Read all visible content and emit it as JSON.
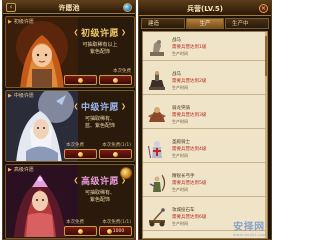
{
  "left_panel": {
    "title": "许愿池",
    "back_icon": "back-arrow-icon",
    "gem_icon": "gem-icon",
    "pools": [
      {
        "tag": "初级许愿",
        "name": "初级许愿",
        "desc_line1": "可抽取稀有以上",
        "desc_line2": "紫色配饰",
        "free_left": "",
        "free_right": "本次免费",
        "price": "",
        "accent": "#f0c868"
      },
      {
        "tag": "中级许愿",
        "name": "中级许愿",
        "desc_line1": "可抽取稀有、",
        "desc_line2": "蓝、紫色配饰",
        "free_left": "本次免费",
        "free_right": "本次免费(1/1)",
        "price": "",
        "accent": "#9fb8f0"
      },
      {
        "tag": "高级许愿",
        "name": "高级许愿",
        "desc_line1": "可抽取稀有、",
        "desc_line2": "紫色配饰",
        "free_left": "本次免费",
        "free_right": "本次免费(1/1)",
        "price": "1000",
        "accent": "#e89ad8"
      }
    ]
  },
  "right_panel": {
    "title": "兵营(LV.5)",
    "close_icon": "close-icon",
    "tabs": [
      "建造",
      "生产",
      "生产中"
    ],
    "active_tab": 1,
    "units": [
      {
        "name": "战马",
        "req": "需要兵营达到1级",
        "time": "生产时间",
        "icon": "horse-statue-icon"
      },
      {
        "name": "战马",
        "req": "需要兵营达到2级",
        "time": "生产时间",
        "icon": "mounted-unit-icon"
      },
      {
        "name": "骑龙突骑",
        "req": "需要兵营达到3级",
        "time": "生产时间",
        "icon": "dragon-rider-icon"
      },
      {
        "name": "圣殿骑士",
        "req": "需要兵营达到4级",
        "time": "生产时间",
        "icon": "templar-knight-icon"
      },
      {
        "name": "精锐长弓手",
        "req": "需要兵营达到5级",
        "time": "生产时间",
        "icon": "longbow-archer-icon"
      },
      {
        "name": "攻城投石车",
        "req": "需要兵营达到6级",
        "time": "生产时间",
        "icon": "catapult-icon"
      }
    ]
  },
  "watermark": {
    "main": "安择网",
    "sub": "www.anzhi.com"
  }
}
